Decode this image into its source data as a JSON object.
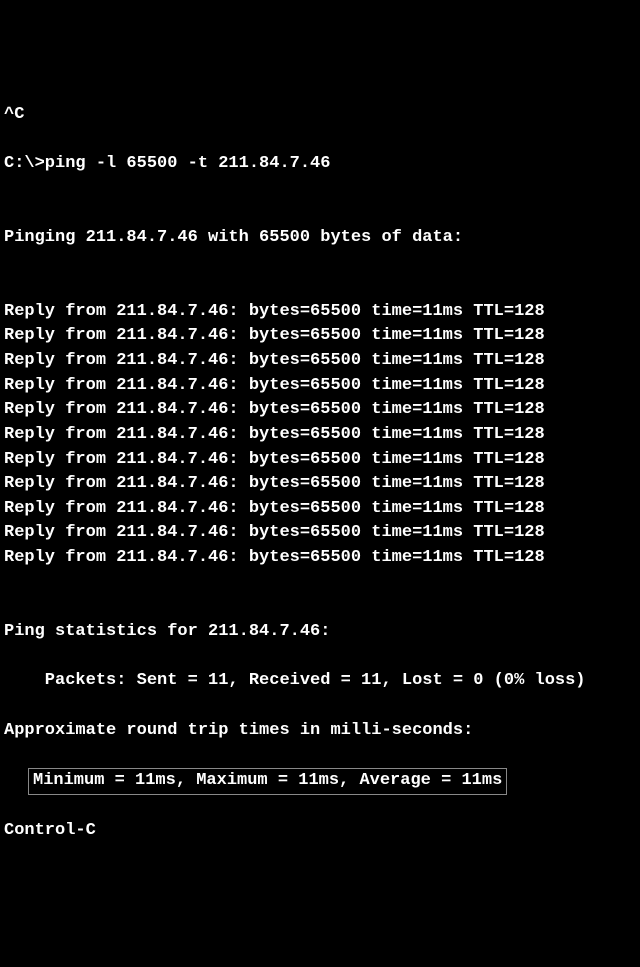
{
  "interrupt": "^C",
  "prompt": "C:\\>ping -l 65500 -t 211.84.7.46",
  "blank1": "",
  "header": "Pinging 211.84.7.46 with 65500 bytes of data:",
  "blank2": "",
  "replies": [
    "Reply from 211.84.7.46: bytes=65500 time=11ms TTL=128",
    "Reply from 211.84.7.46: bytes=65500 time=11ms TTL=128",
    "Reply from 211.84.7.46: bytes=65500 time=11ms TTL=128",
    "Reply from 211.84.7.46: bytes=65500 time=11ms TTL=128",
    "Reply from 211.84.7.46: bytes=65500 time=11ms TTL=128",
    "Reply from 211.84.7.46: bytes=65500 time=11ms TTL=128",
    "Reply from 211.84.7.46: bytes=65500 time=11ms TTL=128",
    "Reply from 211.84.7.46: bytes=65500 time=11ms TTL=128",
    "Reply from 211.84.7.46: bytes=65500 time=11ms TTL=128",
    "Reply from 211.84.7.46: bytes=65500 time=11ms TTL=128",
    "Reply from 211.84.7.46: bytes=65500 time=11ms TTL=128"
  ],
  "blank3": "",
  "stats_header": "Ping statistics for 211.84.7.46:",
  "packets_line": "    Packets: Sent = 11, Received = 11, Lost = 0 (0% loss)",
  "approx_line": "Approximate round trip times in milli-seconds:",
  "timing_line": "Minimum = 11ms, Maximum = 11ms, Average = 11ms",
  "control_c": "Control-C"
}
